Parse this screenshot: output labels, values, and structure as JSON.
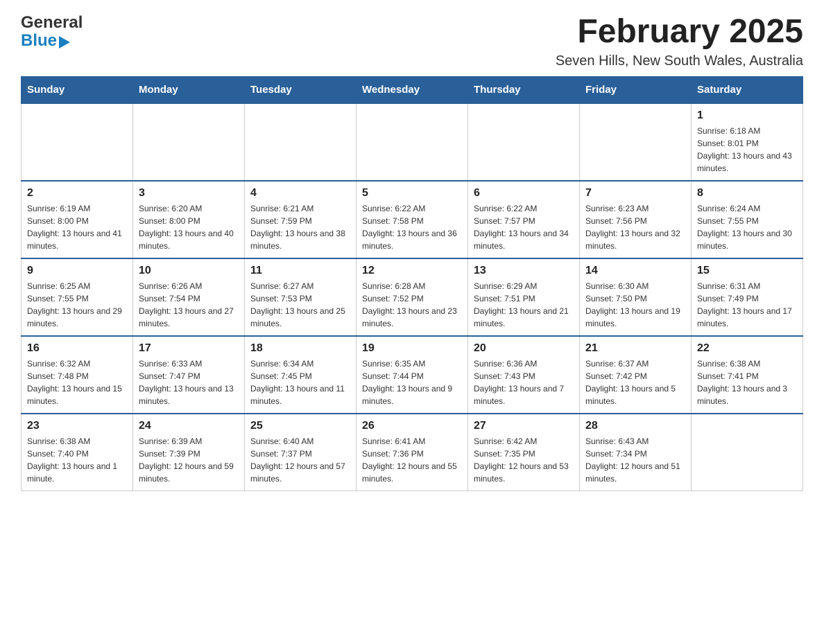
{
  "header": {
    "logo_general": "General",
    "logo_blue": "Blue",
    "month_title": "February 2025",
    "subtitle": "Seven Hills, New South Wales, Australia"
  },
  "days_of_week": [
    "Sunday",
    "Monday",
    "Tuesday",
    "Wednesday",
    "Thursday",
    "Friday",
    "Saturday"
  ],
  "weeks": [
    [
      {
        "day": "",
        "info": ""
      },
      {
        "day": "",
        "info": ""
      },
      {
        "day": "",
        "info": ""
      },
      {
        "day": "",
        "info": ""
      },
      {
        "day": "",
        "info": ""
      },
      {
        "day": "",
        "info": ""
      },
      {
        "day": "1",
        "info": "Sunrise: 6:18 AM\nSunset: 8:01 PM\nDaylight: 13 hours and 43 minutes."
      }
    ],
    [
      {
        "day": "2",
        "info": "Sunrise: 6:19 AM\nSunset: 8:00 PM\nDaylight: 13 hours and 41 minutes."
      },
      {
        "day": "3",
        "info": "Sunrise: 6:20 AM\nSunset: 8:00 PM\nDaylight: 13 hours and 40 minutes."
      },
      {
        "day": "4",
        "info": "Sunrise: 6:21 AM\nSunset: 7:59 PM\nDaylight: 13 hours and 38 minutes."
      },
      {
        "day": "5",
        "info": "Sunrise: 6:22 AM\nSunset: 7:58 PM\nDaylight: 13 hours and 36 minutes."
      },
      {
        "day": "6",
        "info": "Sunrise: 6:22 AM\nSunset: 7:57 PM\nDaylight: 13 hours and 34 minutes."
      },
      {
        "day": "7",
        "info": "Sunrise: 6:23 AM\nSunset: 7:56 PM\nDaylight: 13 hours and 32 minutes."
      },
      {
        "day": "8",
        "info": "Sunrise: 6:24 AM\nSunset: 7:55 PM\nDaylight: 13 hours and 30 minutes."
      }
    ],
    [
      {
        "day": "9",
        "info": "Sunrise: 6:25 AM\nSunset: 7:55 PM\nDaylight: 13 hours and 29 minutes."
      },
      {
        "day": "10",
        "info": "Sunrise: 6:26 AM\nSunset: 7:54 PM\nDaylight: 13 hours and 27 minutes."
      },
      {
        "day": "11",
        "info": "Sunrise: 6:27 AM\nSunset: 7:53 PM\nDaylight: 13 hours and 25 minutes."
      },
      {
        "day": "12",
        "info": "Sunrise: 6:28 AM\nSunset: 7:52 PM\nDaylight: 13 hours and 23 minutes."
      },
      {
        "day": "13",
        "info": "Sunrise: 6:29 AM\nSunset: 7:51 PM\nDaylight: 13 hours and 21 minutes."
      },
      {
        "day": "14",
        "info": "Sunrise: 6:30 AM\nSunset: 7:50 PM\nDaylight: 13 hours and 19 minutes."
      },
      {
        "day": "15",
        "info": "Sunrise: 6:31 AM\nSunset: 7:49 PM\nDaylight: 13 hours and 17 minutes."
      }
    ],
    [
      {
        "day": "16",
        "info": "Sunrise: 6:32 AM\nSunset: 7:48 PM\nDaylight: 13 hours and 15 minutes."
      },
      {
        "day": "17",
        "info": "Sunrise: 6:33 AM\nSunset: 7:47 PM\nDaylight: 13 hours and 13 minutes."
      },
      {
        "day": "18",
        "info": "Sunrise: 6:34 AM\nSunset: 7:45 PM\nDaylight: 13 hours and 11 minutes."
      },
      {
        "day": "19",
        "info": "Sunrise: 6:35 AM\nSunset: 7:44 PM\nDaylight: 13 hours and 9 minutes."
      },
      {
        "day": "20",
        "info": "Sunrise: 6:36 AM\nSunset: 7:43 PM\nDaylight: 13 hours and 7 minutes."
      },
      {
        "day": "21",
        "info": "Sunrise: 6:37 AM\nSunset: 7:42 PM\nDaylight: 13 hours and 5 minutes."
      },
      {
        "day": "22",
        "info": "Sunrise: 6:38 AM\nSunset: 7:41 PM\nDaylight: 13 hours and 3 minutes."
      }
    ],
    [
      {
        "day": "23",
        "info": "Sunrise: 6:38 AM\nSunset: 7:40 PM\nDaylight: 13 hours and 1 minute."
      },
      {
        "day": "24",
        "info": "Sunrise: 6:39 AM\nSunset: 7:39 PM\nDaylight: 12 hours and 59 minutes."
      },
      {
        "day": "25",
        "info": "Sunrise: 6:40 AM\nSunset: 7:37 PM\nDaylight: 12 hours and 57 minutes."
      },
      {
        "day": "26",
        "info": "Sunrise: 6:41 AM\nSunset: 7:36 PM\nDaylight: 12 hours and 55 minutes."
      },
      {
        "day": "27",
        "info": "Sunrise: 6:42 AM\nSunset: 7:35 PM\nDaylight: 12 hours and 53 minutes."
      },
      {
        "day": "28",
        "info": "Sunrise: 6:43 AM\nSunset: 7:34 PM\nDaylight: 12 hours and 51 minutes."
      },
      {
        "day": "",
        "info": ""
      }
    ]
  ]
}
